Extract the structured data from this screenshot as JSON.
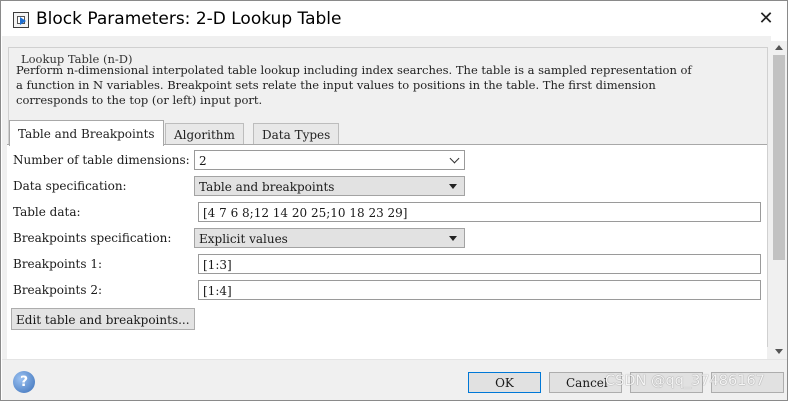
{
  "window": {
    "title": "Block Parameters: 2-D Lookup Table",
    "close_glyph": "✕",
    "icon": "simulink-block-icon"
  },
  "group": {
    "legend": "Lookup Table (n-D)",
    "description_lines": [
      "Perform n-dimensional interpolated table lookup including index searches. The table is a sampled representation of",
      "a function in N variables. Breakpoint sets relate the input values to positions in the table. The first dimension",
      "corresponds to the top (or left) input port."
    ]
  },
  "tabs": [
    {
      "label": "Table and Breakpoints",
      "active": true
    },
    {
      "label": "Algorithm",
      "active": false
    },
    {
      "label": "Data Types",
      "active": false
    }
  ],
  "form": {
    "dimensions_label": "Number of table dimensions:",
    "dimensions_value": "2",
    "data_spec_label": "Data specification:",
    "data_spec_value": "Table and breakpoints",
    "table_data_label": "Table data:",
    "table_data_value": "[4 7 6 8;12 14 20 25;10 18 23 29]",
    "bp_spec_label": "Breakpoints specification:",
    "bp_spec_value": "Explicit values",
    "bp1_label": "Breakpoints 1:",
    "bp1_value": "[1:3]",
    "bp2_label": "Breakpoints 2:",
    "bp2_value": "[1:4]",
    "edit_button": "Edit table and breakpoints..."
  },
  "footer": {
    "help_glyph": "?",
    "ok": "OK",
    "cancel": "Cancel",
    "watermark": "CSDN @qq_37486167"
  },
  "colors": {
    "dialog_bg": "#f0f0f0",
    "panel_bg": "#ffffff",
    "ok_border": "#0078d7",
    "grey_combo": "#e2e2e2"
  }
}
